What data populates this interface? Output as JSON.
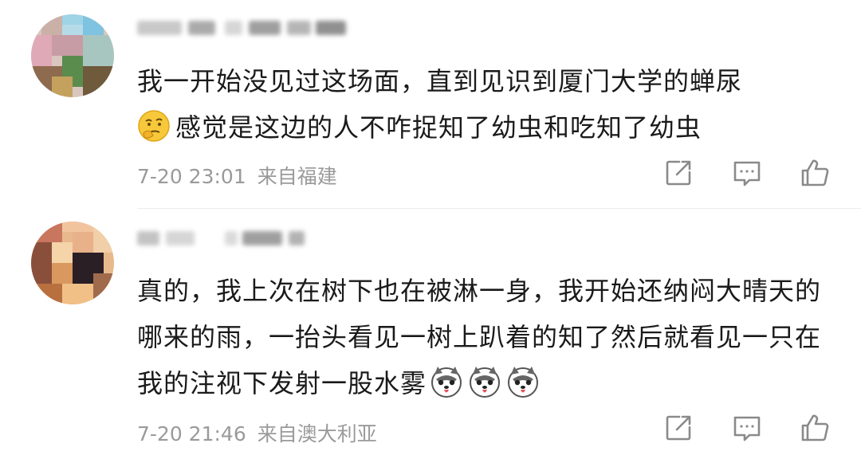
{
  "comments": [
    {
      "text": "我一开始没见过这场面，直到见识到厦门大学的蝉尿感觉是这边的人不咋捉知了幼虫和吃知了幼虫",
      "text_before_emoji": "我一开始没见过这场面，直到见识到厦门大学的蝉尿",
      "emoji_inline": "thinking-emoji",
      "text_after_emoji": "感觉是这边的人不咋捉知了幼虫和吃知了幼虫",
      "time": "7-20 23:01",
      "location": "来自福建",
      "actions": [
        "share-icon",
        "comment-icon",
        "like-icon"
      ]
    },
    {
      "text": "真的，我上次在树下也在被淋一身，我开始还纳闷大晴天的哪来的雨，一抬头看见一树上趴着的知了然后就看见一只在我的注视下发射一股水雾",
      "trailing_emoji": [
        "husky-emoji",
        "husky-emoji",
        "husky-emoji"
      ],
      "time": "7-20 21:46",
      "location": "来自澳大利亚",
      "actions": [
        "share-icon",
        "comment-icon",
        "like-icon"
      ]
    }
  ],
  "colors": {
    "text": "#1a1a1a",
    "meta": "#9a9a9a",
    "icon": "#8a8a8a",
    "divider": "#ececec",
    "background": "#ffffff"
  }
}
